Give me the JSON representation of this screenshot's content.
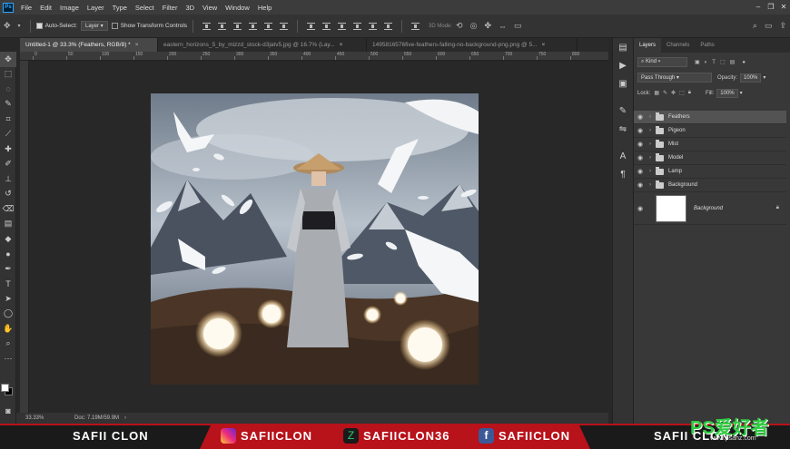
{
  "app": {
    "logo": "Ps"
  },
  "menu": [
    "File",
    "Edit",
    "Image",
    "Layer",
    "Type",
    "Select",
    "Filter",
    "3D",
    "View",
    "Window",
    "Help"
  ],
  "window_controls": [
    "–",
    "❐",
    "✕"
  ],
  "options": {
    "auto_select_label": "Auto-Select:",
    "auto_select_value": "Layer",
    "transform_controls_label": "Show Transform Controls",
    "mode_label": "3D Mode:"
  },
  "tabs": [
    {
      "label": "Untitled-1 @ 33.3% (Feathers, RGB/8) *",
      "close": "×"
    },
    {
      "label": "eastern_horizons_5_by_mizzd_stock-d3jatv5.jpg @ 16.7% (Lay...",
      "close": "×"
    },
    {
      "label": "1495816576five-feathers-falling-no-background-png.png @ 5...",
      "close": "×"
    }
  ],
  "ruler_labels": [
    "0",
    "50",
    "100",
    "150",
    "200",
    "250",
    "300",
    "350",
    "400",
    "450",
    "500",
    "550",
    "600",
    "650",
    "700",
    "750",
    "800"
  ],
  "status": {
    "zoom": "33.33%",
    "doc": "Doc: 7.19M/59.9M"
  },
  "panel": {
    "tabs": [
      "Layers",
      "Channels",
      "Paths"
    ],
    "kind_label": "Kind",
    "blend_mode": "Pass Through",
    "opacity_label": "Opacity:",
    "opacity_value": "100%",
    "lock_label": "Lock:",
    "fill_label": "Fill:",
    "fill_value": "100%"
  },
  "layers": [
    {
      "name": "Feathers",
      "active": true
    },
    {
      "name": "Pigeon",
      "active": false
    },
    {
      "name": "Mist",
      "active": false
    },
    {
      "name": "Model",
      "active": false
    },
    {
      "name": "Lamp",
      "active": false
    },
    {
      "name": "Background",
      "active": false
    }
  ],
  "background_layer": {
    "name": "Background"
  },
  "banner": {
    "left": "SAFII CLON",
    "instagram": "SAFIICLON",
    "other": "SAFIICLON36",
    "facebook": "SAFIICLON",
    "right": "SAFII CLON",
    "watermark": "PS爱好者",
    "watermark_url": "www.psahz.com"
  },
  "colors": {
    "accent": "#31a8ff",
    "banner_red": "#b8121b"
  }
}
